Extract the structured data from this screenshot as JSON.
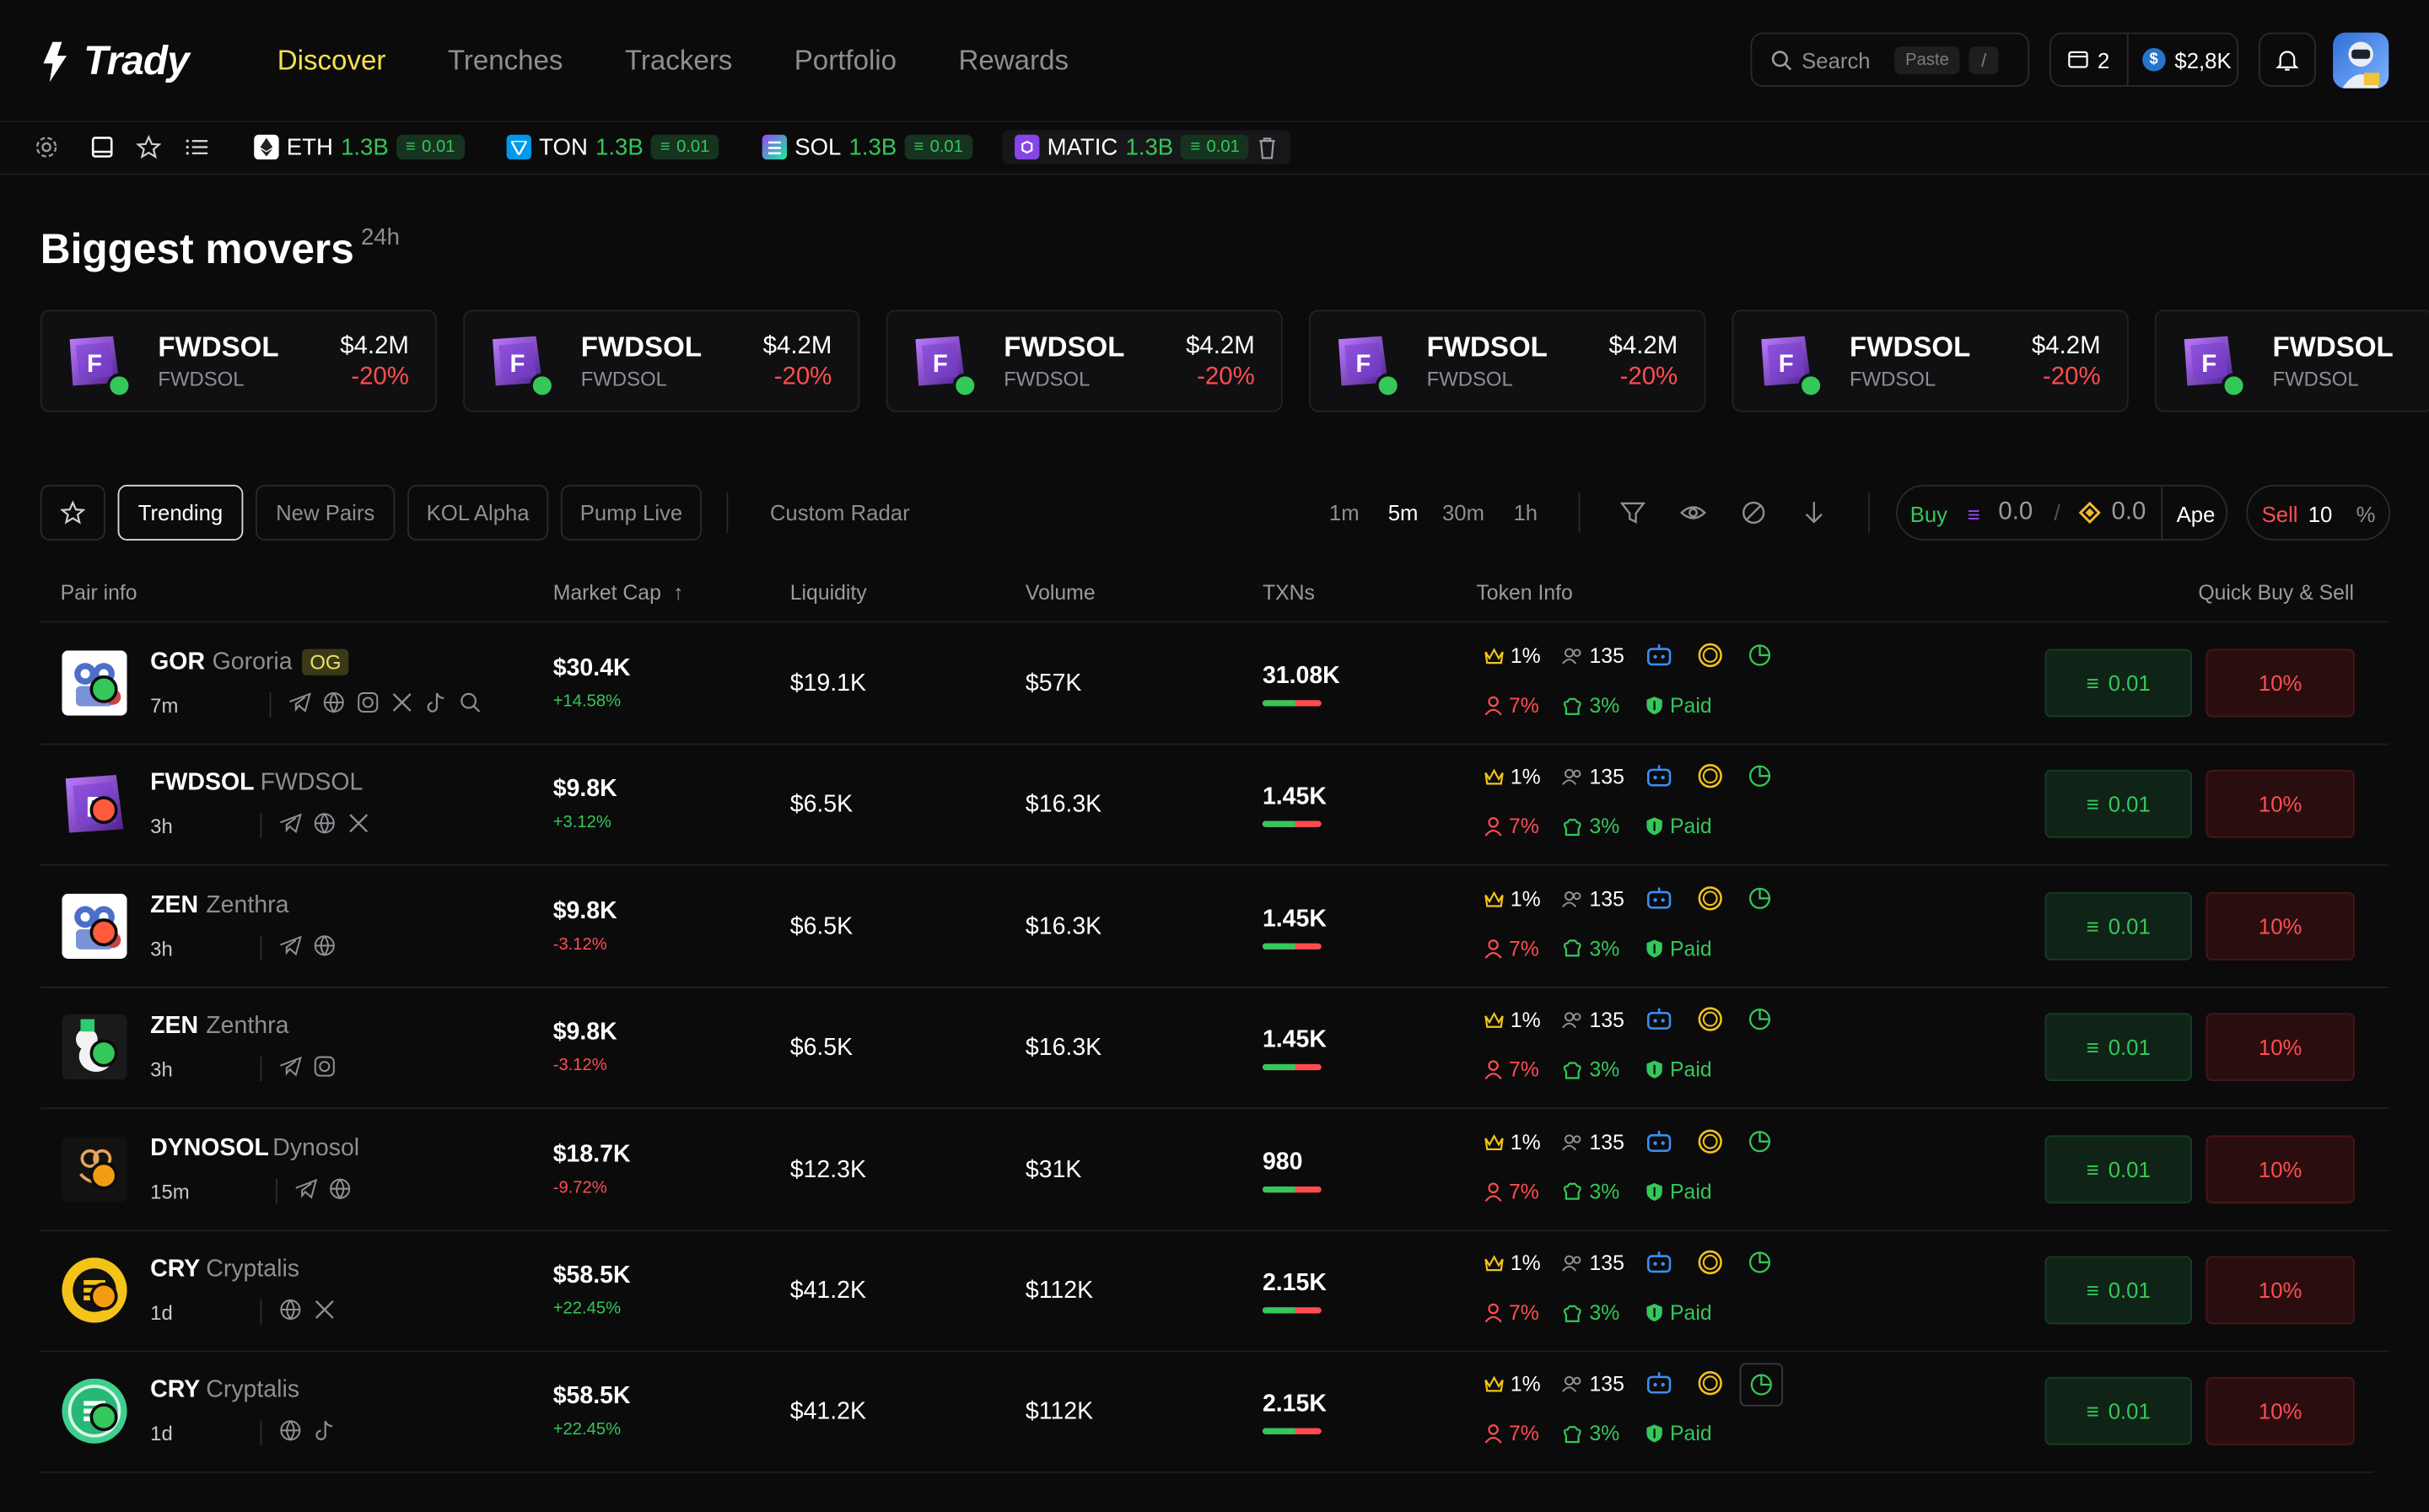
{
  "app": {
    "name": "Trady"
  },
  "nav": [
    "Discover",
    "Trenches",
    "Trackers",
    "Portfolio",
    "Rewards"
  ],
  "search": {
    "label": "Search",
    "paste": "Paste",
    "shortcut": "/"
  },
  "wallet": {
    "count": "2",
    "balance": "$2,8K"
  },
  "chains": [
    {
      "name": "ETH",
      "volume": "1.3B",
      "amount": "0.01",
      "color": "#ffffff"
    },
    {
      "name": "TON",
      "volume": "1.3B",
      "amount": "0.01",
      "color": "#0098ea"
    },
    {
      "name": "SOL",
      "volume": "1.3B",
      "amount": "0.01",
      "color": "#9945ff"
    },
    {
      "name": "MATIC",
      "volume": "1.3B",
      "amount": "0.01",
      "color": "#8247e5"
    }
  ],
  "movers": {
    "title": "Biggest movers",
    "period": "24h",
    "cards": [
      {
        "symbol": "FWDSOL",
        "name": "FWDSOL",
        "price": "$4.2M",
        "change": "-20%"
      },
      {
        "symbol": "FWDSOL",
        "name": "FWDSOL",
        "price": "$4.2M",
        "change": "-20%"
      },
      {
        "symbol": "FWDSOL",
        "name": "FWDSOL",
        "price": "$4.2M",
        "change": "-20%"
      },
      {
        "symbol": "FWDSOL",
        "name": "FWDSOL",
        "price": "$4.2M",
        "change": "-20%"
      },
      {
        "symbol": "FWDSOL",
        "name": "FWDSOL",
        "price": "$4.2M",
        "change": "-20%"
      },
      {
        "symbol": "FWDSOL",
        "name": "FWDSOL",
        "price": "",
        "change": ""
      }
    ]
  },
  "filters": {
    "tabs": [
      "Trending",
      "New Pairs",
      "KOL Alpha",
      "Pump Live"
    ],
    "custom": "Custom Radar",
    "timeframes": [
      "1m",
      "5m",
      "30m",
      "1h"
    ],
    "buy_label": "Buy",
    "buy_sol": "0.0",
    "buy_bnb": "0.0",
    "separator": "/",
    "ape": "Ape",
    "sell_label": "Sell",
    "sell_value": "10",
    "sell_unit": "%"
  },
  "table": {
    "columns": [
      "Pair info",
      "Market Cap",
      "Liquidity",
      "Volume",
      "TXNs",
      "Token Info",
      "Quick Buy & Sell"
    ],
    "rows": [
      {
        "symbol": "GOR",
        "name": "Gororia",
        "tag": "OG",
        "age": "7m",
        "mcap": "$30.4K",
        "mcap_change": "+14.58%",
        "liquidity": "$19.1K",
        "volume": "$57K",
        "txns": "31.08K",
        "top": "1%",
        "holders": "135",
        "snipers": "7%",
        "insiders": "3%",
        "paid": "Paid",
        "buy": "0.01",
        "sell": "10%"
      },
      {
        "symbol": "FWDSOL",
        "name": "FWDSOL",
        "tag": "",
        "age": "3h",
        "mcap": "$9.8K",
        "mcap_change": "+3.12%",
        "liquidity": "$6.5K",
        "volume": "$16.3K",
        "txns": "1.45K",
        "top": "1%",
        "holders": "135",
        "snipers": "7%",
        "insiders": "3%",
        "paid": "Paid",
        "buy": "0.01",
        "sell": "10%"
      },
      {
        "symbol": "ZEN",
        "name": "Zenthra",
        "tag": "",
        "age": "3h",
        "mcap": "$9.8K",
        "mcap_change": "-3.12%",
        "liquidity": "$6.5K",
        "volume": "$16.3K",
        "txns": "1.45K",
        "top": "1%",
        "holders": "135",
        "snipers": "7%",
        "insiders": "3%",
        "paid": "Paid",
        "buy": "0.01",
        "sell": "10%"
      },
      {
        "symbol": "ZEN",
        "name": "Zenthra",
        "tag": "",
        "age": "3h",
        "mcap": "$9.8K",
        "mcap_change": "-3.12%",
        "liquidity": "$6.5K",
        "volume": "$16.3K",
        "txns": "1.45K",
        "top": "1%",
        "holders": "135",
        "snipers": "7%",
        "insiders": "3%",
        "paid": "Paid",
        "buy": "0.01",
        "sell": "10%"
      },
      {
        "symbol": "DYNOSOL",
        "name": "Dynosol",
        "tag": "",
        "age": "15m",
        "mcap": "$18.7K",
        "mcap_change": "-9.72%",
        "liquidity": "$12.3K",
        "volume": "$31K",
        "txns": "980",
        "top": "1%",
        "holders": "135",
        "snipers": "7%",
        "insiders": "3%",
        "paid": "Paid",
        "buy": "0.01",
        "sell": "10%"
      },
      {
        "symbol": "CRY",
        "name": "Cryptalis",
        "tag": "",
        "age": "1d",
        "mcap": "$58.5K",
        "mcap_change": "+22.45%",
        "liquidity": "$41.2K",
        "volume": "$112K",
        "txns": "2.15K",
        "top": "1%",
        "holders": "135",
        "snipers": "7%",
        "insiders": "3%",
        "paid": "Paid",
        "buy": "0.01",
        "sell": "10%"
      },
      {
        "symbol": "CRY",
        "name": "Cryptalis",
        "tag": "",
        "age": "1d",
        "mcap": "$58.5K",
        "mcap_change": "+22.45%",
        "liquidity": "$41.2K",
        "volume": "$112K",
        "txns": "2.15K",
        "top": "1%",
        "holders": "135",
        "snipers": "7%",
        "insiders": "3%",
        "paid": "Paid",
        "buy": "0.01",
        "sell": "10%"
      }
    ]
  }
}
